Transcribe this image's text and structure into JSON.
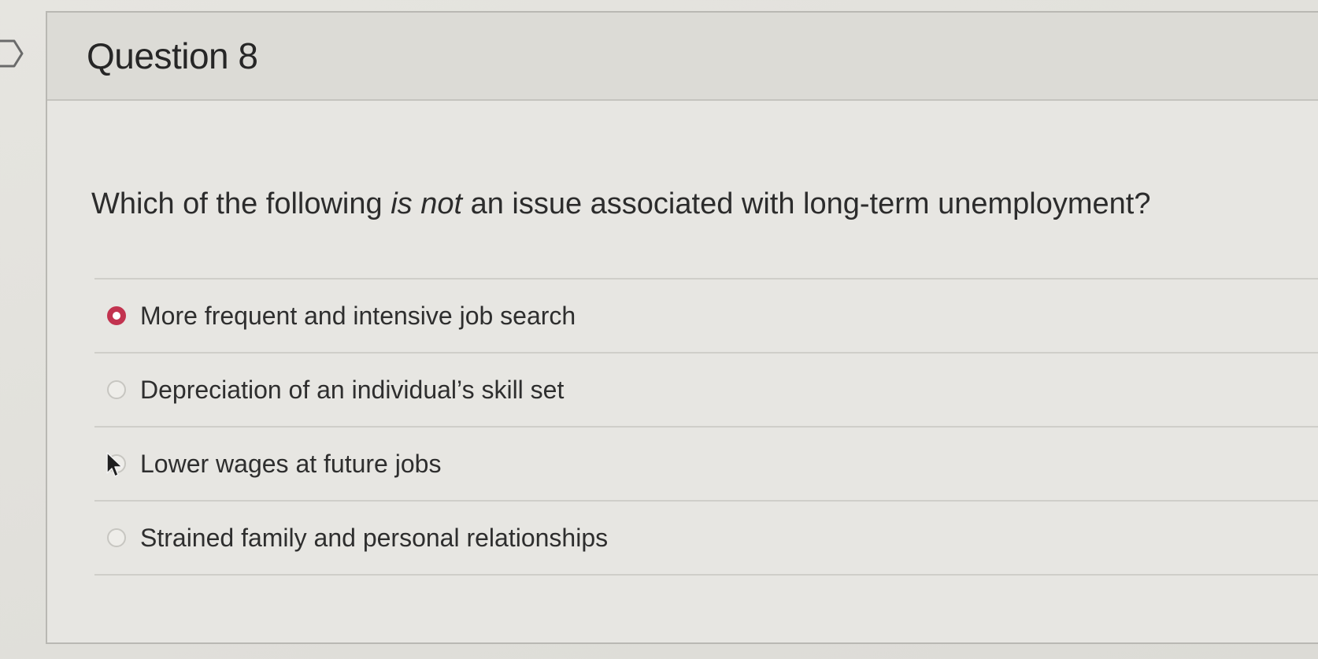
{
  "question": {
    "title": "Question 8",
    "prompt_before": "Which of the following ",
    "prompt_emphasis": "is not",
    "prompt_after": " an issue associated with long-term unemployment?"
  },
  "answers": [
    {
      "label": "More frequent and intensive job search",
      "selected": true
    },
    {
      "label": "Depreciation of an individual’s skill set",
      "selected": false
    },
    {
      "label": "Lower wages at future jobs",
      "selected": false
    },
    {
      "label": "Strained family and personal relationships",
      "selected": false
    }
  ],
  "colors": {
    "selected_radio": "#c2334f",
    "background": "#e5e4e0"
  }
}
